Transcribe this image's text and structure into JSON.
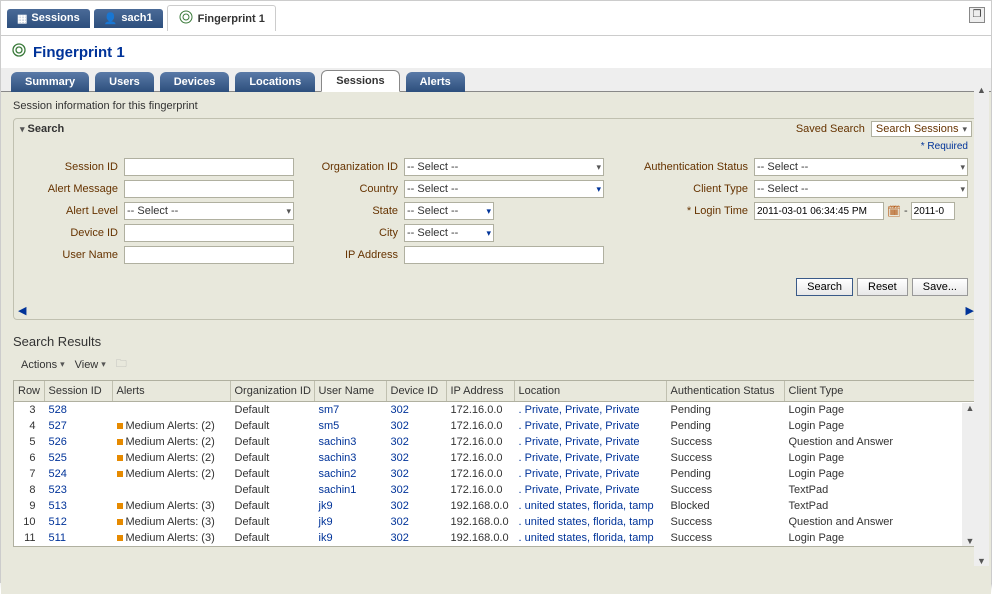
{
  "top_tabs": [
    {
      "label": "Sessions",
      "active": false
    },
    {
      "label": "sach1",
      "active": false
    },
    {
      "label": "Fingerprint 1",
      "active": true
    }
  ],
  "page_title": "Fingerprint 1",
  "nav_tabs": [
    {
      "label": "Summary",
      "active": false
    },
    {
      "label": "Users",
      "active": false
    },
    {
      "label": "Devices",
      "active": false
    },
    {
      "label": "Locations",
      "active": false
    },
    {
      "label": "Sessions",
      "active": true
    },
    {
      "label": "Alerts",
      "active": false
    }
  ],
  "description": "Session information for this fingerprint",
  "search": {
    "title": "Search",
    "saved_label": "Saved Search",
    "saved_value": "Search Sessions",
    "required": "* Required",
    "labels": {
      "session_id": "Session ID",
      "alert_message": "Alert Message",
      "alert_level": "Alert Level",
      "device_id": "Device ID",
      "user_name": "User Name",
      "org_id": "Organization ID",
      "country": "Country",
      "state": "State",
      "city": "City",
      "ip_address": "IP Address",
      "auth_status": "Authentication Status",
      "client_type": "Client Type",
      "login_time": "* Login Time"
    },
    "select_placeholder": "-- Select --",
    "login_time_value": "2011-03-01 06:34:45 PM",
    "login_time_to": "2011-0",
    "dash": "-",
    "buttons": {
      "search": "Search",
      "reset": "Reset",
      "save": "Save..."
    }
  },
  "results": {
    "title": "Search Results",
    "toolbar": {
      "actions": "Actions",
      "view": "View"
    },
    "columns": [
      "Row",
      "Session ID",
      "Alerts",
      "Organization ID",
      "User Name",
      "Device ID",
      "IP Address",
      "Location",
      "Authentication Status",
      "Client Type"
    ],
    "rows": [
      {
        "row": "3",
        "sid": "528",
        "alerts": "",
        "org": "Default",
        "user": "sm7",
        "dev": "302",
        "ip": "172.16.0.0",
        "loc": "Private, Private, Private",
        "auth": "Pending",
        "client": "Login Page"
      },
      {
        "row": "4",
        "sid": "527",
        "alerts": "Medium Alerts: (2)",
        "org": "Default",
        "user": "sm5",
        "dev": "302",
        "ip": "172.16.0.0",
        "loc": "Private, Private, Private",
        "auth": "Pending",
        "client": "Login Page"
      },
      {
        "row": "5",
        "sid": "526",
        "alerts": "Medium Alerts: (2)",
        "org": "Default",
        "user": "sachin3",
        "dev": "302",
        "ip": "172.16.0.0",
        "loc": "Private, Private, Private",
        "auth": "Success",
        "client": "Question and Answer"
      },
      {
        "row": "6",
        "sid": "525",
        "alerts": "Medium Alerts: (2)",
        "org": "Default",
        "user": "sachin3",
        "dev": "302",
        "ip": "172.16.0.0",
        "loc": "Private, Private, Private",
        "auth": "Success",
        "client": "Login Page"
      },
      {
        "row": "7",
        "sid": "524",
        "alerts": "Medium Alerts: (2)",
        "org": "Default",
        "user": "sachin2",
        "dev": "302",
        "ip": "172.16.0.0",
        "loc": "Private, Private, Private",
        "auth": "Pending",
        "client": "Login Page"
      },
      {
        "row": "8",
        "sid": "523",
        "alerts": "",
        "org": "Default",
        "user": "sachin1",
        "dev": "302",
        "ip": "172.16.0.0",
        "loc": "Private, Private, Private",
        "auth": "Success",
        "client": "TextPad"
      },
      {
        "row": "9",
        "sid": "513",
        "alerts": "Medium Alerts: (3)",
        "org": "Default",
        "user": "jk9",
        "dev": "302",
        "ip": "192.168.0.0",
        "loc": "united states, florida, tamp",
        "auth": "Blocked",
        "client": "TextPad"
      },
      {
        "row": "10",
        "sid": "512",
        "alerts": "Medium Alerts: (3)",
        "org": "Default",
        "user": "jk9",
        "dev": "302",
        "ip": "192.168.0.0",
        "loc": "united states, florida, tamp",
        "auth": "Success",
        "client": "Question and Answer"
      },
      {
        "row": "11",
        "sid": "511",
        "alerts": "Medium Alerts: (3)",
        "org": "Default",
        "user": "ik9",
        "dev": "302",
        "ip": "192.168.0.0",
        "loc": "united states, florida, tamp",
        "auth": "Success",
        "client": "Login Page"
      }
    ]
  }
}
